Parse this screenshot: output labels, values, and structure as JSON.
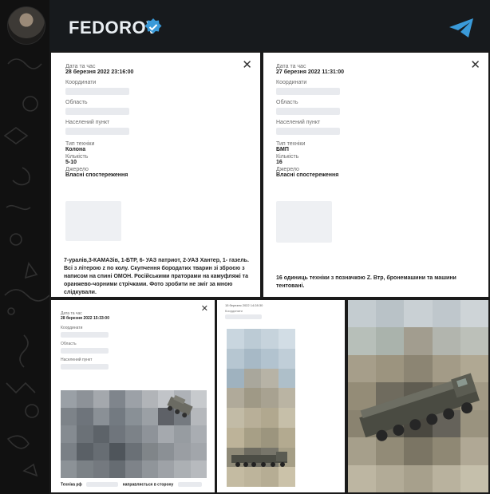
{
  "channel": {
    "title": "FEDOROV",
    "verified_icon": "verified-badge-icon",
    "send_icon": "telegram-send-icon",
    "accent": "#3a9ad9"
  },
  "cards": {
    "card1": {
      "fields": [
        {
          "label": "Дата та час",
          "value": "28 березня 2022 23:16:00"
        },
        {
          "label": "Координати",
          "value": ""
        },
        {
          "label": "Область",
          "value": ""
        },
        {
          "label": "Населений пункт",
          "value": ""
        },
        {
          "label": "Тип техніки",
          "value": "Колона"
        },
        {
          "label": "Кількість",
          "value": "5-10"
        },
        {
          "label": "Джерело",
          "value": "Власні спостереження"
        }
      ],
      "description": "7-уралів,3-КАМАЗів, 1-БТР, 6- УАЗ патриот, 2-УАЗ Хантер, 1- газель. Всі з літерою z по колу. Скупчення бородатих тварин зі зброєю з написом на спині ОМОН. Російськими праторами на камуфляжі та оранжево-чорними стрічками. Фото зробити не зміг за мною слідкували."
    },
    "card2": {
      "fields": [
        {
          "label": "Дата та час",
          "value": "27 березня 2022 11:31:00"
        },
        {
          "label": "Координати",
          "value": ""
        },
        {
          "label": "Область",
          "value": ""
        },
        {
          "label": "Населений пункт",
          "value": ""
        },
        {
          "label": "Тип техніки",
          "value": "БМП"
        },
        {
          "label": "Кількість",
          "value": "16"
        },
        {
          "label": "Джерело",
          "value": "Власні спостереження"
        }
      ],
      "description": "16 одиниць техніки з позначкою Z. Втр, бронемашини та машини тентовані."
    },
    "card3": {
      "fields": [
        {
          "label": "Дата та час",
          "value": "28 березня 2022 15:33:00"
        },
        {
          "label": "Координати",
          "value": ""
        },
        {
          "label": "Область",
          "value": ""
        },
        {
          "label": "Населений пункт",
          "value": ""
        }
      ],
      "footer_left": "Техніка рф",
      "footer_right": "направляється в сторону"
    },
    "card4": {
      "date": "15 березня 2022 14:28:30",
      "label": "Координати"
    }
  }
}
